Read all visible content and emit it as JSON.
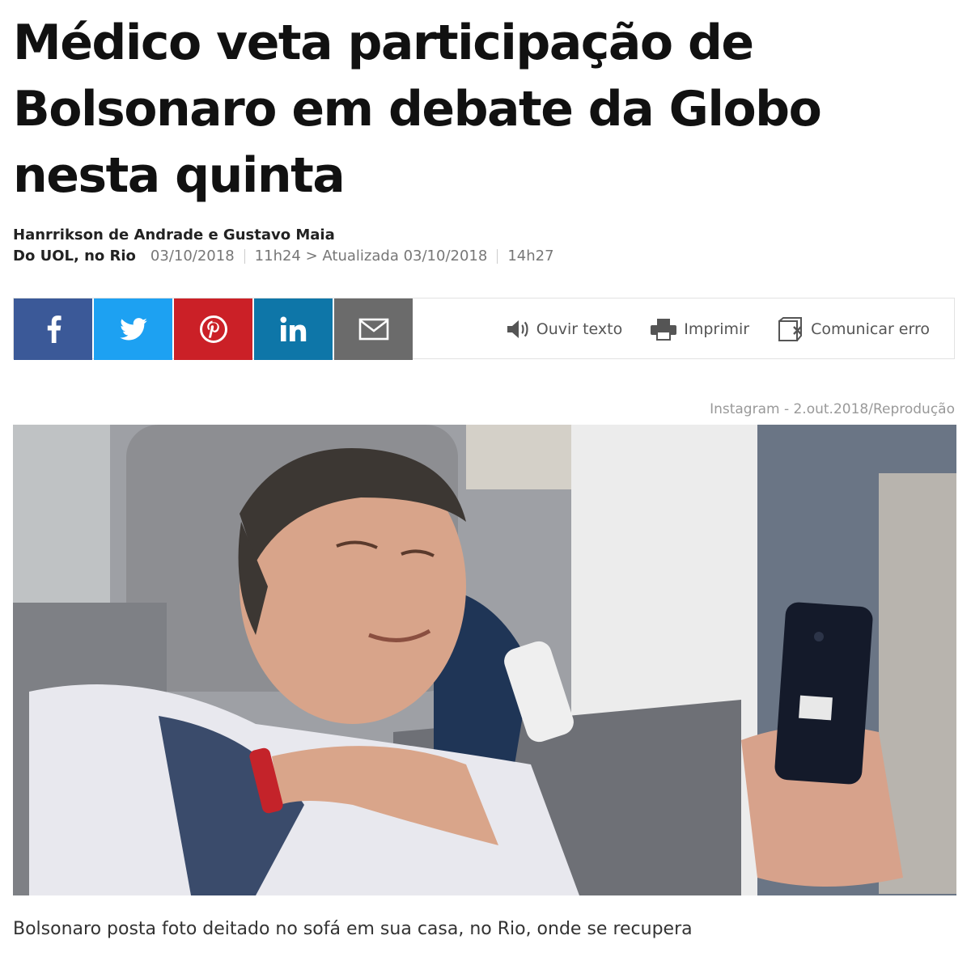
{
  "article": {
    "headline": "Médico veta participação de Bolsonaro em debate da Globo nesta quinta",
    "authors": "Hanrrikson de Andrade e Gustavo Maia",
    "source": "Do UOL, no Rio",
    "date": "03/10/2018",
    "time_updated": "11h24 > Atualizada 03/10/2018",
    "time": "14h27"
  },
  "share": {
    "buttons": [
      {
        "id": "facebook",
        "icon": "facebook-icon",
        "color": "#3b5998"
      },
      {
        "id": "twitter",
        "icon": "twitter-icon",
        "color": "#1da1f2"
      },
      {
        "id": "pinterest",
        "icon": "pinterest-icon",
        "color": "#cb2027"
      },
      {
        "id": "linkedin",
        "icon": "linkedin-icon",
        "color": "#0e76a8"
      },
      {
        "id": "email",
        "icon": "envelope-icon",
        "color": "#6b6b6b"
      }
    ],
    "tools": {
      "listen_label": "Ouvir texto",
      "print_label": "Imprimir",
      "report_label": "Comunicar erro"
    }
  },
  "photo": {
    "credit": "Instagram - 2.out.2018/Reprodução",
    "caption": "Bolsonaro posta foto deitado no sofá em sua casa, no Rio, onde se recupera"
  }
}
